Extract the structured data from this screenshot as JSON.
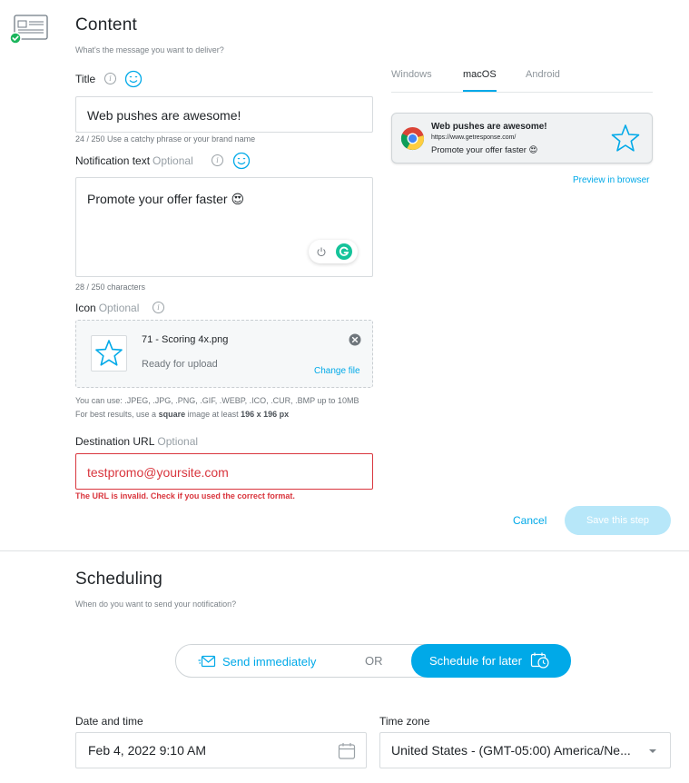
{
  "content": {
    "heading": "Content",
    "subheading": "What's the message you want to deliver?",
    "title_field": {
      "label": "Title",
      "value": "Web pushes are awesome!",
      "hint": "24 / 250 Use a catchy phrase or your brand name"
    },
    "notification_text": {
      "label": "Notification text",
      "optional": "Optional",
      "value": "Promote your offer faster 😍",
      "hint": "28 / 250 characters"
    },
    "icon_field": {
      "label": "Icon",
      "optional": "Optional",
      "file_name": "71 - Scoring 4x.png",
      "status": "Ready for upload",
      "change_link": "Change file",
      "hint_line1": "You can use: .JPEG, .JPG, .PNG, .GIF, .WEBP, .ICO, .CUR, .BMP up to 10MB",
      "hint_line2_prefix": "For best results, use a",
      "hint_line2_bold1": "square",
      "hint_line2_mid": "image at least",
      "hint_line2_bold2": "196 x 196 px"
    },
    "destination_url": {
      "label": "Destination URL",
      "optional": "Optional",
      "value": "testpromo@yoursite.com",
      "error": "The URL is invalid. Check if you used the correct format."
    }
  },
  "preview": {
    "tabs": [
      "Windows",
      "macOS",
      "Android"
    ],
    "active_tab": "macOS",
    "card_title": "Web pushes are awesome!",
    "card_url": "https://www.getresponse.com/",
    "card_body": "Promote your offer faster 😍",
    "preview_link": "Preview in browser"
  },
  "actions": {
    "cancel": "Cancel",
    "save": "Save this step"
  },
  "scheduling": {
    "heading": "Scheduling",
    "subheading": "When do you want to send your notification?",
    "send_immediately": "Send immediately",
    "or": "OR",
    "schedule_later": "Schedule for later",
    "date_label": "Date and time",
    "date_value": "Feb 4, 2022 9:10 AM",
    "tz_label": "Time zone",
    "tz_value": "United States - (GMT-05:00) America/Ne..."
  },
  "colors": {
    "accent": "#00a9e8",
    "error": "#d9363e",
    "success": "#1bb55c",
    "save_disabled": "#b7e7f9"
  }
}
